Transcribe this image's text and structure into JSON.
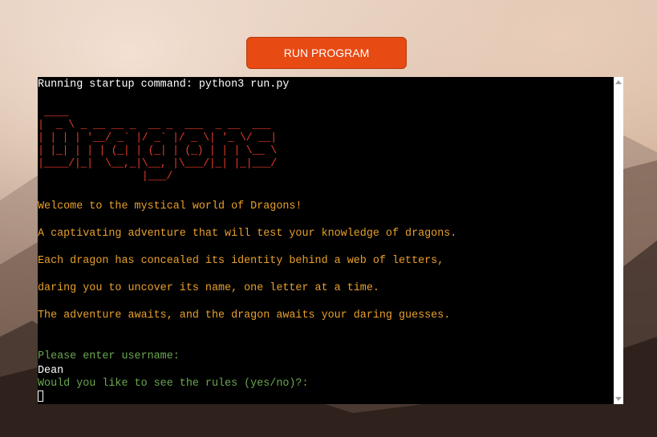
{
  "toolbar": {
    "run_label": "RUN PROGRAM"
  },
  "terminal": {
    "startup": "Running startup command: python3 run.py",
    "banner": " ____\n|  _ \\ _ __ __ _  __ _  ___  _ __  ___\n| | | | '__/ _` |/ _` |/ _ \\| '_ \\/ __|\n| |_| | | | (_| | (_| | (_) | | | \\__ \\\n|____/|_|  \\__,_|\\__, |\\___/|_| |_|___/\n                 |___/",
    "welcome": "Welcome to the mystical world of Dragons!",
    "intro1": "A captivating adventure that will test your knowledge of dragons.",
    "intro2": "Each dragon has concealed its identity behind a web of letters,",
    "intro3": "daring you to uncover its name, one letter at a time.",
    "intro4": "The adventure awaits, and the dragon awaits your daring guesses.",
    "prompt_username": "Please enter username:",
    "username_value": "Dean",
    "prompt_rules": "Would you like to see the rules (yes/no)?:"
  },
  "colors": {
    "button": "#e84a14",
    "terminal_bg": "#000000",
    "text_white": "#ffffff",
    "text_orange": "#e8a02a",
    "text_red": "#e23a2a",
    "text_green": "#6aa84f"
  }
}
